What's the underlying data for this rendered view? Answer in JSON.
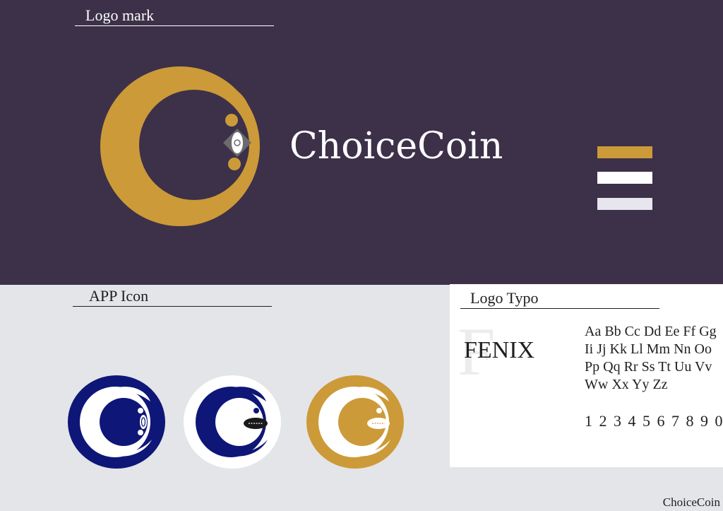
{
  "sections": {
    "logo_mark": "Logo mark",
    "app_icon": "APP Icon",
    "logo_typo": "Logo Typo"
  },
  "brand": {
    "name": "ChoiceCoin",
    "colors": {
      "background_dark": "#3c3149",
      "gold": "#cc9a38",
      "navy": "#0e1777",
      "white": "#ffffff",
      "light_gray": "#e4e5e8"
    }
  },
  "palette_swatches": [
    "#cc9a38",
    "#ffffff",
    "#e7e5ee"
  ],
  "typography": {
    "sample_letter": "F",
    "font_name": "FENIX",
    "alphabet_lines": [
      "Aa Bb Cc Dd Ee Ff Gg",
      "Ii Jj Kk Ll Mm Nn Oo",
      "Pp Qq Rr Ss Tt Uu Vv",
      "Ww Xx Yy Zz"
    ],
    "digits": "1 2 3 4 5 6 7 8 9 0"
  },
  "app_icons": [
    {
      "name": "navy-background-icon",
      "background": "#0e1777",
      "crescent": "#ffffff",
      "inner": "#0e1777"
    },
    {
      "name": "white-background-icon",
      "background": "#ffffff",
      "crescent": "#0e1777",
      "inner": "#ffffff"
    },
    {
      "name": "gold-background-icon",
      "background": "#cc9a38",
      "crescent": "#ffffff",
      "inner": "#cc9a38"
    }
  ],
  "footer": "ChoiceCoin"
}
